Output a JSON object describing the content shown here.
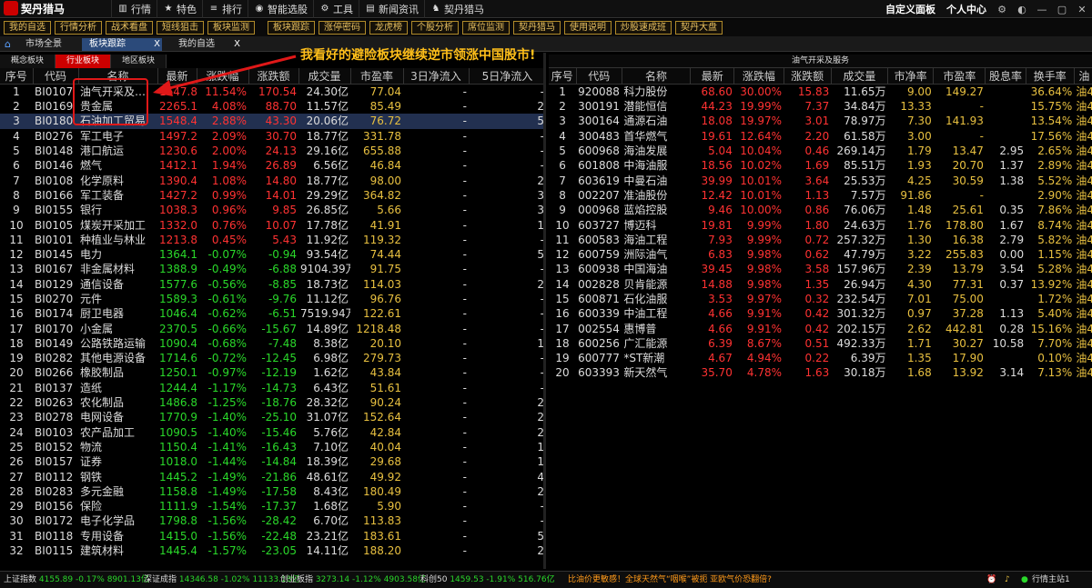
{
  "app": {
    "title": "契丹猎马"
  },
  "menu": [
    {
      "icon": "chart-icon",
      "glyph": "▥",
      "label": "行情"
    },
    {
      "icon": "star-icon",
      "glyph": "★",
      "label": "特色"
    },
    {
      "icon": "rank-icon",
      "glyph": "≡",
      "label": "排行"
    },
    {
      "icon": "brain-icon",
      "glyph": "◉",
      "label": "智能选股"
    },
    {
      "icon": "tools-icon",
      "glyph": "⚙",
      "label": "工具"
    },
    {
      "icon": "news-icon",
      "glyph": "▤",
      "label": "新闻资讯"
    },
    {
      "icon": "horse-icon",
      "glyph": "♞",
      "label": "契丹猎马"
    }
  ],
  "right_menu": {
    "custom_panel": "自定义面板",
    "user_center": "个人中心"
  },
  "toolbar": {
    "group1": [
      "我的自选",
      "行情分析",
      "战术看盘",
      "短线狙击",
      "板块监测"
    ],
    "group2": [
      "板块跟踪",
      "涨停密码",
      "龙虎榜",
      "个股分析",
      "席位监测",
      "契丹猎马",
      "使用说明",
      "炒股速成班",
      "契丹大盘"
    ]
  },
  "tabs": {
    "market": "市场全景",
    "sector": "板块跟踪",
    "watch": "我的自选",
    "close": "X"
  },
  "annotation": "我看好的避险板块继续逆市领涨中国股市!",
  "left": {
    "subtabs": [
      "概念板块",
      "行业板块",
      "地区板块"
    ],
    "columns": [
      "序号",
      "代码",
      "名称",
      "最新",
      "涨跌幅",
      "涨跌额",
      "成交量",
      "市盈率",
      "3日净流入",
      "5日净流入"
    ],
    "rows": [
      [
        "1",
        "BI0107",
        "油气开采及…",
        "1647.86",
        "11.54%",
        "170.54",
        "24.30亿",
        "77.04",
        "-",
        "-"
      ],
      [
        "2",
        "BI0169",
        "贵金属",
        "2265.13",
        "4.08%",
        "88.70",
        "11.57亿",
        "85.49",
        "-",
        "2"
      ],
      [
        "3",
        "BI0180",
        "石油加工贸易",
        "1548.49",
        "2.88%",
        "43.30",
        "20.06亿",
        "76.72",
        "-",
        "5"
      ],
      [
        "4",
        "BI0276",
        "军工电子",
        "1497.28",
        "2.09%",
        "30.70",
        "18.77亿",
        "331.78",
        "-",
        "-"
      ],
      [
        "5",
        "BI0148",
        "港口航运",
        "1230.62",
        "2.00%",
        "24.13",
        "29.16亿",
        "655.88",
        "-",
        "-"
      ],
      [
        "6",
        "BI0146",
        "燃气",
        "1412.15",
        "1.94%",
        "26.89",
        "6.56亿",
        "46.84",
        "-",
        "-"
      ],
      [
        "7",
        "BI0108",
        "化学原料",
        "1390.48",
        "1.08%",
        "14.80",
        "18.77亿",
        "98.00",
        "-",
        "2"
      ],
      [
        "8",
        "BI0166",
        "军工装备",
        "1427.28",
        "0.99%",
        "14.01",
        "29.29亿",
        "364.82",
        "-",
        "3"
      ],
      [
        "9",
        "BI0155",
        "银行",
        "1038.32",
        "0.96%",
        "9.85",
        "26.85亿",
        "5.66",
        "-",
        "3"
      ],
      [
        "10",
        "BI0105",
        "煤炭开采加工",
        "1332.00",
        "0.76%",
        "10.07",
        "17.78亿",
        "41.91",
        "-",
        "1"
      ],
      [
        "11",
        "BI0101",
        "种植业与林业",
        "1213.83",
        "0.45%",
        "5.43",
        "11.92亿",
        "119.32",
        "-",
        "-"
      ],
      [
        "12",
        "BI0145",
        "电力",
        "1364.10",
        "-0.07%",
        "-0.94",
        "93.54亿",
        "74.44",
        "-",
        "5"
      ],
      [
        "13",
        "BI0167",
        "非金属材料",
        "1388.95",
        "-0.49%",
        "-6.88",
        "9104.39万",
        "91.75",
        "-",
        "-"
      ],
      [
        "14",
        "BI0129",
        "通信设备",
        "1577.60",
        "-0.56%",
        "-8.85",
        "18.73亿",
        "114.03",
        "-",
        "2"
      ],
      [
        "15",
        "BI0270",
        "元件",
        "1589.34",
        "-0.61%",
        "-9.76",
        "11.12亿",
        "96.76",
        "-",
        "-"
      ],
      [
        "16",
        "BI0174",
        "厨卫电器",
        "1046.46",
        "-0.62%",
        "-6.51",
        "7519.94万",
        "122.61",
        "-",
        "-"
      ],
      [
        "17",
        "BI0170",
        "小金属",
        "2370.55",
        "-0.66%",
        "-15.67",
        "14.89亿",
        "1218.48",
        "-",
        "-"
      ],
      [
        "18",
        "BI0149",
        "公路铁路运输",
        "1090.43",
        "-0.68%",
        "-7.48",
        "8.38亿",
        "20.10",
        "-",
        "1"
      ],
      [
        "19",
        "BI0282",
        "其他电源设备",
        "1714.66",
        "-0.72%",
        "-12.45",
        "6.98亿",
        "279.73",
        "-",
        "-"
      ],
      [
        "20",
        "BI0266",
        "橡胶制品",
        "1250.15",
        "-0.97%",
        "-12.19",
        "1.62亿",
        "43.84",
        "-",
        "-"
      ],
      [
        "21",
        "BI0137",
        "造纸",
        "1244.40",
        "-1.17%",
        "-14.73",
        "6.43亿",
        "51.61",
        "-",
        "-"
      ],
      [
        "22",
        "BI0263",
        "农化制品",
        "1486.87",
        "-1.25%",
        "-18.76",
        "28.32亿",
        "90.24",
        "-",
        "2"
      ],
      [
        "23",
        "BI0278",
        "电网设备",
        "1770.91",
        "-1.40%",
        "-25.10",
        "31.07亿",
        "152.64",
        "-",
        "2"
      ],
      [
        "24",
        "BI0103",
        "农产品加工",
        "1090.53",
        "-1.40%",
        "-15.46",
        "5.76亿",
        "42.84",
        "-",
        "2"
      ],
      [
        "25",
        "BI0152",
        "物流",
        "1150.41",
        "-1.41%",
        "-16.43",
        "7.10亿",
        "40.04",
        "-",
        "1"
      ],
      [
        "26",
        "BI0157",
        "证券",
        "1018.01",
        "-1.44%",
        "-14.84",
        "18.39亿",
        "29.68",
        "-",
        "1"
      ],
      [
        "27",
        "BI0112",
        "钢铁",
        "1445.26",
        "-1.49%",
        "-21.86",
        "48.61亿",
        "49.92",
        "-",
        "4"
      ],
      [
        "28",
        "BI0283",
        "多元金融",
        "1158.87",
        "-1.49%",
        "-17.58",
        "8.43亿",
        "180.49",
        "-",
        "2"
      ],
      [
        "29",
        "BI0156",
        "保险",
        "1111.99",
        "-1.54%",
        "-17.37",
        "1.68亿",
        "5.90",
        "-",
        "-"
      ],
      [
        "30",
        "BI0172",
        "电子化学品",
        "1798.85",
        "-1.56%",
        "-28.42",
        "6.70亿",
        "113.83",
        "-",
        "-"
      ],
      [
        "31",
        "BI0118",
        "专用设备",
        "1415.00",
        "-1.56%",
        "-22.48",
        "23.21亿",
        "183.61",
        "-",
        "5"
      ],
      [
        "32",
        "BI0115",
        "建筑材料",
        "1445.49",
        "-1.57%",
        "-23.05",
        "14.11亿",
        "188.20",
        "-",
        "2"
      ]
    ]
  },
  "right": {
    "title": "油气开采及服务",
    "columns": [
      "序号",
      "代码",
      "名称",
      "最新",
      "涨跌幅",
      "涨跌额",
      "成交量",
      "市净率",
      "市盈率",
      "股息率",
      "换手率",
      "油"
    ],
    "rows": [
      [
        "1",
        "920088",
        "科力股份",
        "68.60",
        "30.00%",
        "15.83",
        "11.65万",
        "9.00",
        "149.27",
        "",
        "36.64%",
        "油4"
      ],
      [
        "2",
        "300191",
        "潜能恒信",
        "44.23",
        "19.99%",
        "7.37",
        "34.84万",
        "13.33",
        "-",
        "",
        "15.75%",
        "油4"
      ],
      [
        "3",
        "300164",
        "通源石油",
        "18.08",
        "19.97%",
        "3.01",
        "78.97万",
        "7.30",
        "141.93",
        "",
        "13.54%",
        "油4"
      ],
      [
        "4",
        "300483",
        "首华燃气",
        "19.61",
        "12.64%",
        "2.20",
        "61.58万",
        "3.00",
        "-",
        "",
        "17.56%",
        "油4"
      ],
      [
        "5",
        "600968",
        "海油发展",
        "5.04",
        "10.04%",
        "0.46",
        "269.14万",
        "1.79",
        "13.47",
        "2.95",
        "2.65%",
        "油4"
      ],
      [
        "6",
        "601808",
        "中海油服",
        "18.56",
        "10.02%",
        "1.69",
        "85.51万",
        "1.93",
        "20.70",
        "1.37",
        "2.89%",
        "油4"
      ],
      [
        "7",
        "603619",
        "中曼石油",
        "39.99",
        "10.01%",
        "3.64",
        "25.53万",
        "4.25",
        "30.59",
        "1.38",
        "5.52%",
        "油4"
      ],
      [
        "8",
        "002207",
        "准油股份",
        "12.42",
        "10.01%",
        "1.13",
        "7.57万",
        "91.86",
        "-",
        "",
        "2.90%",
        "油4"
      ],
      [
        "9",
        "000968",
        "蓝焰控股",
        "9.46",
        "10.00%",
        "0.86",
        "76.06万",
        "1.48",
        "25.61",
        "0.35",
        "7.86%",
        "油4"
      ],
      [
        "10",
        "603727",
        "博迈科",
        "19.81",
        "9.99%",
        "1.80",
        "24.63万",
        "1.76",
        "178.80",
        "1.67",
        "8.74%",
        "油4"
      ],
      [
        "11",
        "600583",
        "海油工程",
        "7.93",
        "9.99%",
        "0.72",
        "257.32万",
        "1.30",
        "16.38",
        "2.79",
        "5.82%",
        "油4"
      ],
      [
        "12",
        "600759",
        "洲际油气",
        "6.83",
        "9.98%",
        "0.62",
        "47.79万",
        "3.22",
        "255.83",
        "0.00",
        "1.15%",
        "油4"
      ],
      [
        "13",
        "600938",
        "中国海油",
        "39.45",
        "9.98%",
        "3.58",
        "157.96万",
        "2.39",
        "13.79",
        "3.54",
        "5.28%",
        "油4"
      ],
      [
        "14",
        "002828",
        "贝肯能源",
        "14.88",
        "9.98%",
        "1.35",
        "26.94万",
        "4.30",
        "77.31",
        "0.37",
        "13.92%",
        "油4"
      ],
      [
        "15",
        "600871",
        "石化油服",
        "3.53",
        "9.97%",
        "0.32",
        "232.54万",
        "7.01",
        "75.00",
        "",
        "1.72%",
        "油4"
      ],
      [
        "16",
        "600339",
        "中油工程",
        "4.66",
        "9.91%",
        "0.42",
        "301.32万",
        "0.97",
        "37.28",
        "1.13",
        "5.40%",
        "油4"
      ],
      [
        "17",
        "002554",
        "惠博普",
        "4.66",
        "9.91%",
        "0.42",
        "202.15万",
        "2.62",
        "442.81",
        "0.28",
        "15.16%",
        "油4"
      ],
      [
        "18",
        "600256",
        "广汇能源",
        "6.39",
        "8.67%",
        "0.51",
        "492.33万",
        "1.71",
        "30.27",
        "10.58",
        "7.70%",
        "油4"
      ],
      [
        "19",
        "600777",
        "*ST新潮",
        "4.67",
        "4.94%",
        "0.22",
        "6.39万",
        "1.35",
        "17.90",
        "",
        "0.10%",
        "油4"
      ],
      [
        "20",
        "603393",
        "新天然气",
        "35.70",
        "4.78%",
        "1.63",
        "30.18万",
        "1.68",
        "13.92",
        "3.14",
        "7.13%",
        "油4"
      ]
    ],
    "yellow_rows": [
      "7",
      "11",
      "20"
    ]
  },
  "status": {
    "sh_label": "上证指数",
    "sh_value": "4155.89",
    "sh_chg": "-0.17%",
    "sh_amt": "8901.13亿",
    "sz_label": "深证成指",
    "sz_value": "14346.58",
    "sz_chg": "-1.02%",
    "sz_amt": "11133.18亿",
    "cy_label": "创业板指",
    "cy_value": "3273.14",
    "cy_chg": "-1.12%",
    "cy_amt": "4903.58亿",
    "kc_label": "科创50",
    "kc_value": "1459.53",
    "kc_chg": "-1.91%",
    "kc_amt": "516.76亿",
    "news": "比油价更敏感！全球天然气“咽喉”被扼 亚欧气价恐翻倍?",
    "station": "行情主站1"
  },
  "colors": {
    "up": "#ff3232",
    "down": "#2ad82a",
    "accent": "#e8c060",
    "selected": "#223050",
    "tab_active": "#c00000"
  }
}
